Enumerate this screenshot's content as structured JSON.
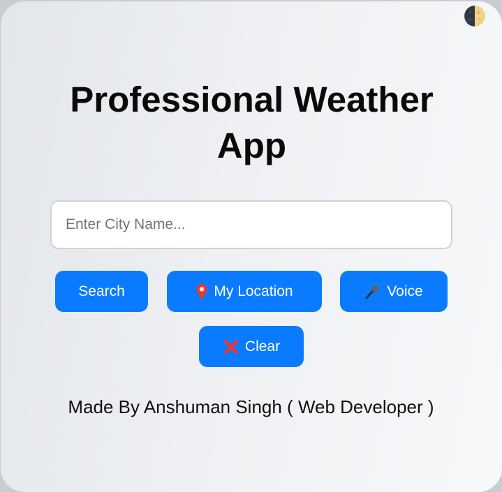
{
  "theme_toggle": {
    "icon": "moon-icon"
  },
  "title": {
    "line1": "Professional Weather",
    "line2": "App"
  },
  "search": {
    "placeholder": "Enter City Name...",
    "value": ""
  },
  "buttons": {
    "search": {
      "label": "Search"
    },
    "location": {
      "label": "My Location",
      "icon": "pin-icon"
    },
    "voice": {
      "label": "Voice",
      "icon": "microphone-icon"
    },
    "clear": {
      "label": "Clear",
      "icon": "cross-icon"
    }
  },
  "footer": {
    "credit": "Made By Anshuman Singh ( Web Developer )"
  },
  "colors": {
    "accent": "#0a7bff",
    "card_bg": "#eef0f3",
    "text": "#0a0a0a"
  }
}
